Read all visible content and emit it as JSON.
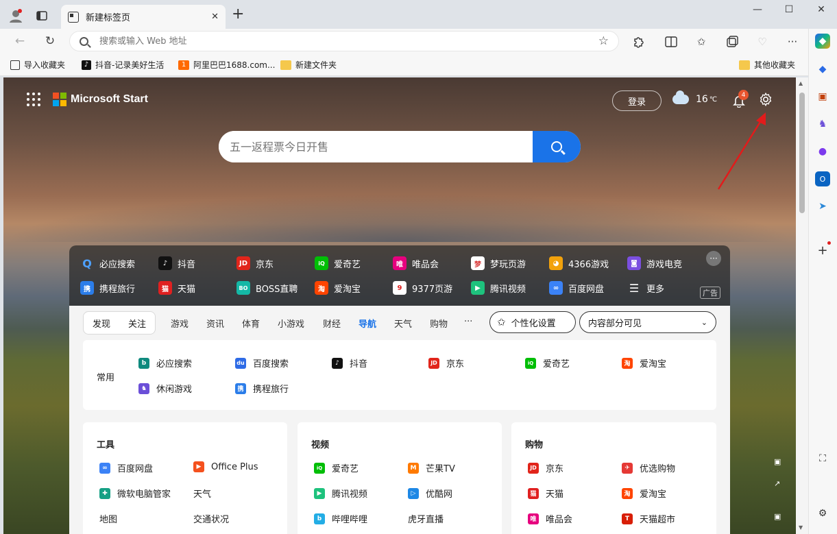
{
  "tab": {
    "title": "新建标签页",
    "close": "✕"
  },
  "omnibox": {
    "placeholder": "搜索或输入 Web 地址"
  },
  "bookmarks": [
    {
      "label": "导入收藏夹",
      "icon": "import-icon"
    },
    {
      "label": "抖音-记录美好生活",
      "icon": "douyin-icon"
    },
    {
      "label": "阿里巴巴1688.com...",
      "icon": "alibaba-icon"
    },
    {
      "label": "新建文件夹",
      "icon": "folder-icon"
    }
  ],
  "other_bookmarks": "其他收藏夹",
  "start": {
    "brand": "Microsoft Start",
    "login": "登录",
    "temperature": "16",
    "temp_unit": "℃",
    "notifications": "4",
    "search_placeholder": "五一返程票今日开售"
  },
  "quick_links": [
    {
      "label": "必应搜索",
      "color": "#1a73e8",
      "glyph": "Q"
    },
    {
      "label": "抖音",
      "color": "#111111",
      "glyph": "♪"
    },
    {
      "label": "京东",
      "color": "#e1251b",
      "glyph": "JD"
    },
    {
      "label": "爱奇艺",
      "color": "#00be06",
      "glyph": "iQ"
    },
    {
      "label": "唯品会",
      "color": "#e6007e",
      "glyph": "唯"
    },
    {
      "label": "梦玩页游",
      "color": "#d93a3a",
      "glyph": "梦"
    },
    {
      "label": "4366游戏",
      "color": "#f2a20c",
      "glyph": "🐱"
    },
    {
      "label": "游戏电竞",
      "color": "#7b4fe0",
      "glyph": "🎮"
    },
    {
      "label": "携程旅行",
      "color": "#2b7de9",
      "glyph": "携"
    },
    {
      "label": "天猫",
      "color": "#e02020",
      "glyph": "猫"
    },
    {
      "label": "BOSS直聘",
      "color": "#14b8a6",
      "glyph": "BO"
    },
    {
      "label": "爱淘宝",
      "color": "#ff4400",
      "glyph": "淘"
    },
    {
      "label": "9377页游",
      "color": "#e02020",
      "glyph": "9"
    },
    {
      "label": "腾讯视频",
      "color": "#1ec27d",
      "glyph": "▶"
    },
    {
      "label": "百度网盘",
      "color": "#3b82f6",
      "glyph": "∞"
    },
    {
      "label": "更多",
      "color": "transparent",
      "glyph": "☰"
    }
  ],
  "ad_label": "广告",
  "feed": {
    "seg": [
      "发现",
      "关注"
    ],
    "tabs": [
      "游戏",
      "资讯",
      "体育",
      "小游戏",
      "财经",
      "导航",
      "天气",
      "购物",
      "···"
    ],
    "active_tab": "导航",
    "personalize": "个性化设置",
    "visibility": "内容部分可见"
  },
  "common": {
    "title": "常用",
    "links": [
      {
        "label": "必应搜索",
        "color": "#0f8a7e",
        "glyph": "b"
      },
      {
        "label": "百度搜索",
        "color": "#2e6be6",
        "glyph": "du"
      },
      {
        "label": "抖音",
        "color": "#111111",
        "glyph": "♪"
      },
      {
        "label": "京东",
        "color": "#e1251b",
        "glyph": "JD"
      },
      {
        "label": "爱奇艺",
        "color": "#00be06",
        "glyph": "iQ"
      },
      {
        "label": "爱淘宝",
        "color": "#ff4400",
        "glyph": "淘"
      },
      {
        "label": "休闲游戏",
        "color": "#6b4fd8",
        "glyph": "♞"
      },
      {
        "label": "携程旅行",
        "color": "#2b7de9",
        "glyph": "携"
      }
    ]
  },
  "sections": [
    {
      "title": "工具",
      "links": [
        {
          "label": "百度网盘",
          "color": "#3b82f6",
          "glyph": "∞"
        },
        {
          "label": "Office Plus",
          "color": "#f4511e",
          "glyph": "▶"
        },
        {
          "label": "微软电脑管家",
          "color": "#16a085",
          "glyph": "✚"
        },
        {
          "label": "天气",
          "color": "",
          "glyph": ""
        },
        {
          "label": "地图",
          "color": "",
          "glyph": ""
        },
        {
          "label": "交通状况",
          "color": "",
          "glyph": ""
        }
      ]
    },
    {
      "title": "视频",
      "links": [
        {
          "label": "爱奇艺",
          "color": "#00be06",
          "glyph": "iQ"
        },
        {
          "label": "芒果TV",
          "color": "#ff7a00",
          "glyph": "M"
        },
        {
          "label": "腾讯视频",
          "color": "#1ec27d",
          "glyph": "▶"
        },
        {
          "label": "优酷网",
          "color": "#1e88e5",
          "glyph": "▷"
        },
        {
          "label": "哔哩哔哩",
          "color": "#23ade5",
          "glyph": "b"
        },
        {
          "label": "虎牙直播",
          "color": "",
          "glyph": ""
        }
      ]
    },
    {
      "title": "购物",
      "links": [
        {
          "label": "京东",
          "color": "#e1251b",
          "glyph": "JD"
        },
        {
          "label": "优选购物",
          "color": "#e53935",
          "glyph": "✈"
        },
        {
          "label": "天猫",
          "color": "#e02020",
          "glyph": "猫"
        },
        {
          "label": "爱淘宝",
          "color": "#ff4400",
          "glyph": "淘"
        },
        {
          "label": "唯品会",
          "color": "#e6007e",
          "glyph": "唯"
        },
        {
          "label": "天猫超市",
          "color": "#d81e06",
          "glyph": "T"
        }
      ]
    }
  ]
}
